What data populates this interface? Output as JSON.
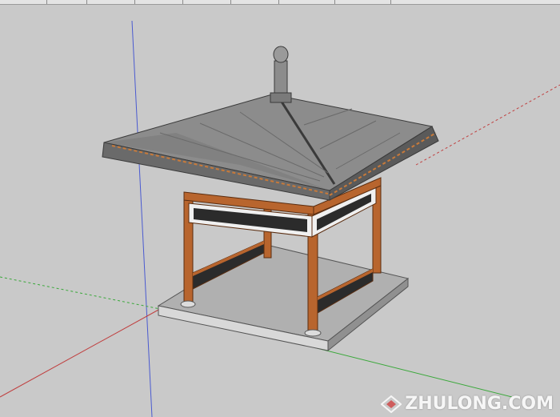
{
  "app": {
    "watermark": {
      "text": "ZHULONG.COM",
      "logo_icon": "diamond-logo-icon"
    }
  },
  "viewport": {
    "background_color": "#c9c9c9",
    "axes": {
      "red_axis_color": "#c04040",
      "green_axis_color": "#3aa83a",
      "blue_axis_color": "#4a5ad0"
    },
    "model": "pavilion"
  },
  "colors": {
    "roof_tile": "#8c8c8c",
    "roof_dark": "#5a5a5a",
    "timber": "#b8652e",
    "platform": "#a8a8a8",
    "lattice": "#2b2b2b"
  }
}
